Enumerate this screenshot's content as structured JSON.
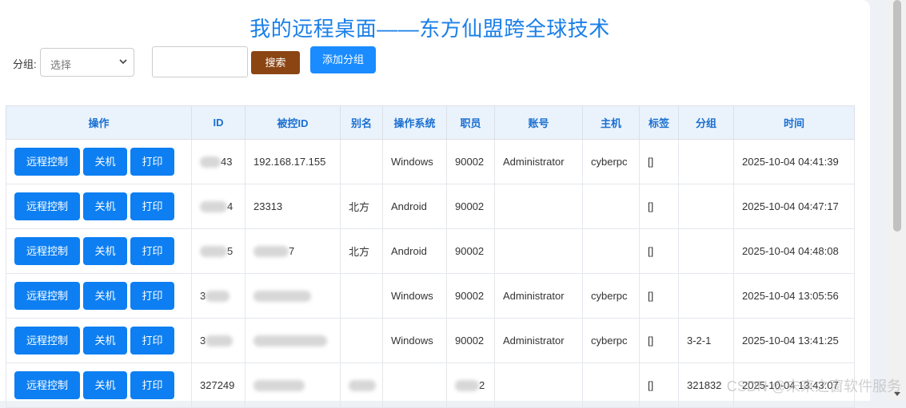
{
  "page": {
    "title": "我的远程桌面——东方仙盟跨全球技术"
  },
  "toolbar": {
    "group_label": "分组:",
    "group_select_value": "选择",
    "search_value": "",
    "search_button": "搜索",
    "add_group_button": "添加分组"
  },
  "table": {
    "headers": [
      "操作",
      "ID",
      "被控ID",
      "别名",
      "操作系统",
      "职员",
      "账号",
      "主机",
      "标签",
      "分组",
      "时间"
    ],
    "op_buttons": {
      "remote": "远程控制",
      "shutdown": "关机",
      "print": "打印"
    },
    "rows": [
      {
        "id": "43",
        "controlled_id": "192.168.17.155",
        "alias": "",
        "os": "Windows",
        "staff": "90002",
        "account": "Administrator",
        "host": "cyberpc",
        "tag": "[]",
        "group": "",
        "time": "2025-10-04 04:41:39"
      },
      {
        "id": "4",
        "controlled_id": "23313",
        "alias": "北方",
        "os": "Android",
        "staff": "90002",
        "account": "",
        "host": "",
        "tag": "[]",
        "group": "",
        "time": "2025-10-04 04:47:17"
      },
      {
        "id": "5",
        "controlled_id": "7",
        "alias": "北方",
        "os": "Android",
        "staff": "90002",
        "account": "",
        "host": "",
        "tag": "[]",
        "group": "",
        "time": "2025-10-04 04:48:08"
      },
      {
        "id": "3",
        "controlled_id": "",
        "alias": "",
        "os": "Windows",
        "staff": "90002",
        "account": "Administrator",
        "host": "cyberpc",
        "tag": "[]",
        "group": "",
        "time": "2025-10-04 13:05:56"
      },
      {
        "id": "3",
        "controlled_id": "",
        "alias": "",
        "os": "Windows",
        "staff": "90002",
        "account": "Administrator",
        "host": "cyberpc",
        "tag": "[]",
        "group": "3-2-1",
        "time": "2025-10-04 13:41:25"
      },
      {
        "id": "327249",
        "controlled_id": "",
        "alias": "",
        "os": "",
        "staff": "2",
        "account": "",
        "host": "",
        "tag": "[]",
        "group": "321832",
        "time": "2025-10-04 13:43:07"
      }
    ]
  },
  "watermark": "CSDN @未来之窗软件服务"
}
